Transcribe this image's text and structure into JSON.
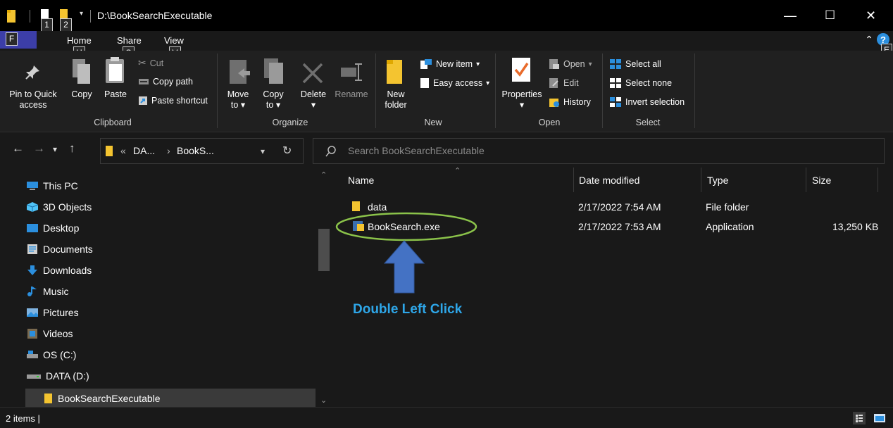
{
  "titlebar": {
    "path": "D:\\BookSearchExecutable",
    "keytips": [
      "1",
      "2",
      "F",
      "H",
      "S",
      "V",
      "E"
    ],
    "controls": {
      "minimize": "—",
      "maximize": "☐",
      "close": "✕"
    }
  },
  "tabs": [
    {
      "label": "Home"
    },
    {
      "label": "Share"
    },
    {
      "label": "View"
    }
  ],
  "ribbon": {
    "clipboard": {
      "pin_line1": "Pin to Quick",
      "pin_line2": "access",
      "copy": "Copy",
      "paste": "Paste",
      "cut": "Cut",
      "copy_path": "Copy path",
      "paste_shortcut": "Paste shortcut",
      "label": "Clipboard"
    },
    "organize": {
      "move": "Move",
      "move_to": "to",
      "copy": "Copy",
      "copy_to": "to",
      "delete": "Delete",
      "rename": "Rename",
      "label": "Organize"
    },
    "new": {
      "new_folder_line1": "New",
      "new_folder_line2": "folder",
      "new_item": "New item",
      "easy_access": "Easy access",
      "label": "New"
    },
    "open": {
      "properties": "Properties",
      "open": "Open",
      "edit": "Edit",
      "history": "History",
      "label": "Open"
    },
    "select": {
      "select_all": "Select all",
      "select_none": "Select none",
      "invert": "Invert selection",
      "label": "Select"
    }
  },
  "address": {
    "overflow": "«",
    "part1": "DA...",
    "sep": "›",
    "part2": "BookS...",
    "search_placeholder": "Search BookSearchExecutable"
  },
  "sidebar": {
    "items": [
      {
        "label": "This PC",
        "icon": "pc-icon"
      },
      {
        "label": "3D Objects",
        "icon": "cube-icon"
      },
      {
        "label": "Desktop",
        "icon": "desktop-icon"
      },
      {
        "label": "Documents",
        "icon": "documents-icon"
      },
      {
        "label": "Downloads",
        "icon": "download-icon"
      },
      {
        "label": "Music",
        "icon": "music-icon"
      },
      {
        "label": "Pictures",
        "icon": "pictures-icon"
      },
      {
        "label": "Videos",
        "icon": "videos-icon"
      },
      {
        "label": "OS (C:)",
        "icon": "drive-c-icon"
      },
      {
        "label": "DATA (D:)",
        "icon": "drive-d-icon"
      },
      {
        "label": "BookSearchExecutable",
        "icon": "folder-icon"
      }
    ]
  },
  "filelist": {
    "columns": [
      "Name",
      "Date modified",
      "Type",
      "Size"
    ],
    "rows": [
      {
        "name": "data",
        "date": "2/17/2022 7:54 AM",
        "type": "File folder",
        "size": ""
      },
      {
        "name": "BookSearch.exe",
        "date": "2/17/2022 7:53 AM",
        "type": "Application",
        "size": "13,250 KB"
      }
    ]
  },
  "annotation": {
    "text": "Double Left Click",
    "color": "#2ea6e8",
    "ellipse_color": "#8bc34a",
    "arrow_color": "#4472c4"
  },
  "status": {
    "items": "2 items  |"
  },
  "colors": {
    "folder": "#f4c430",
    "file_tab": "#3c3ea8",
    "accent_blue": "#2b8fde"
  }
}
